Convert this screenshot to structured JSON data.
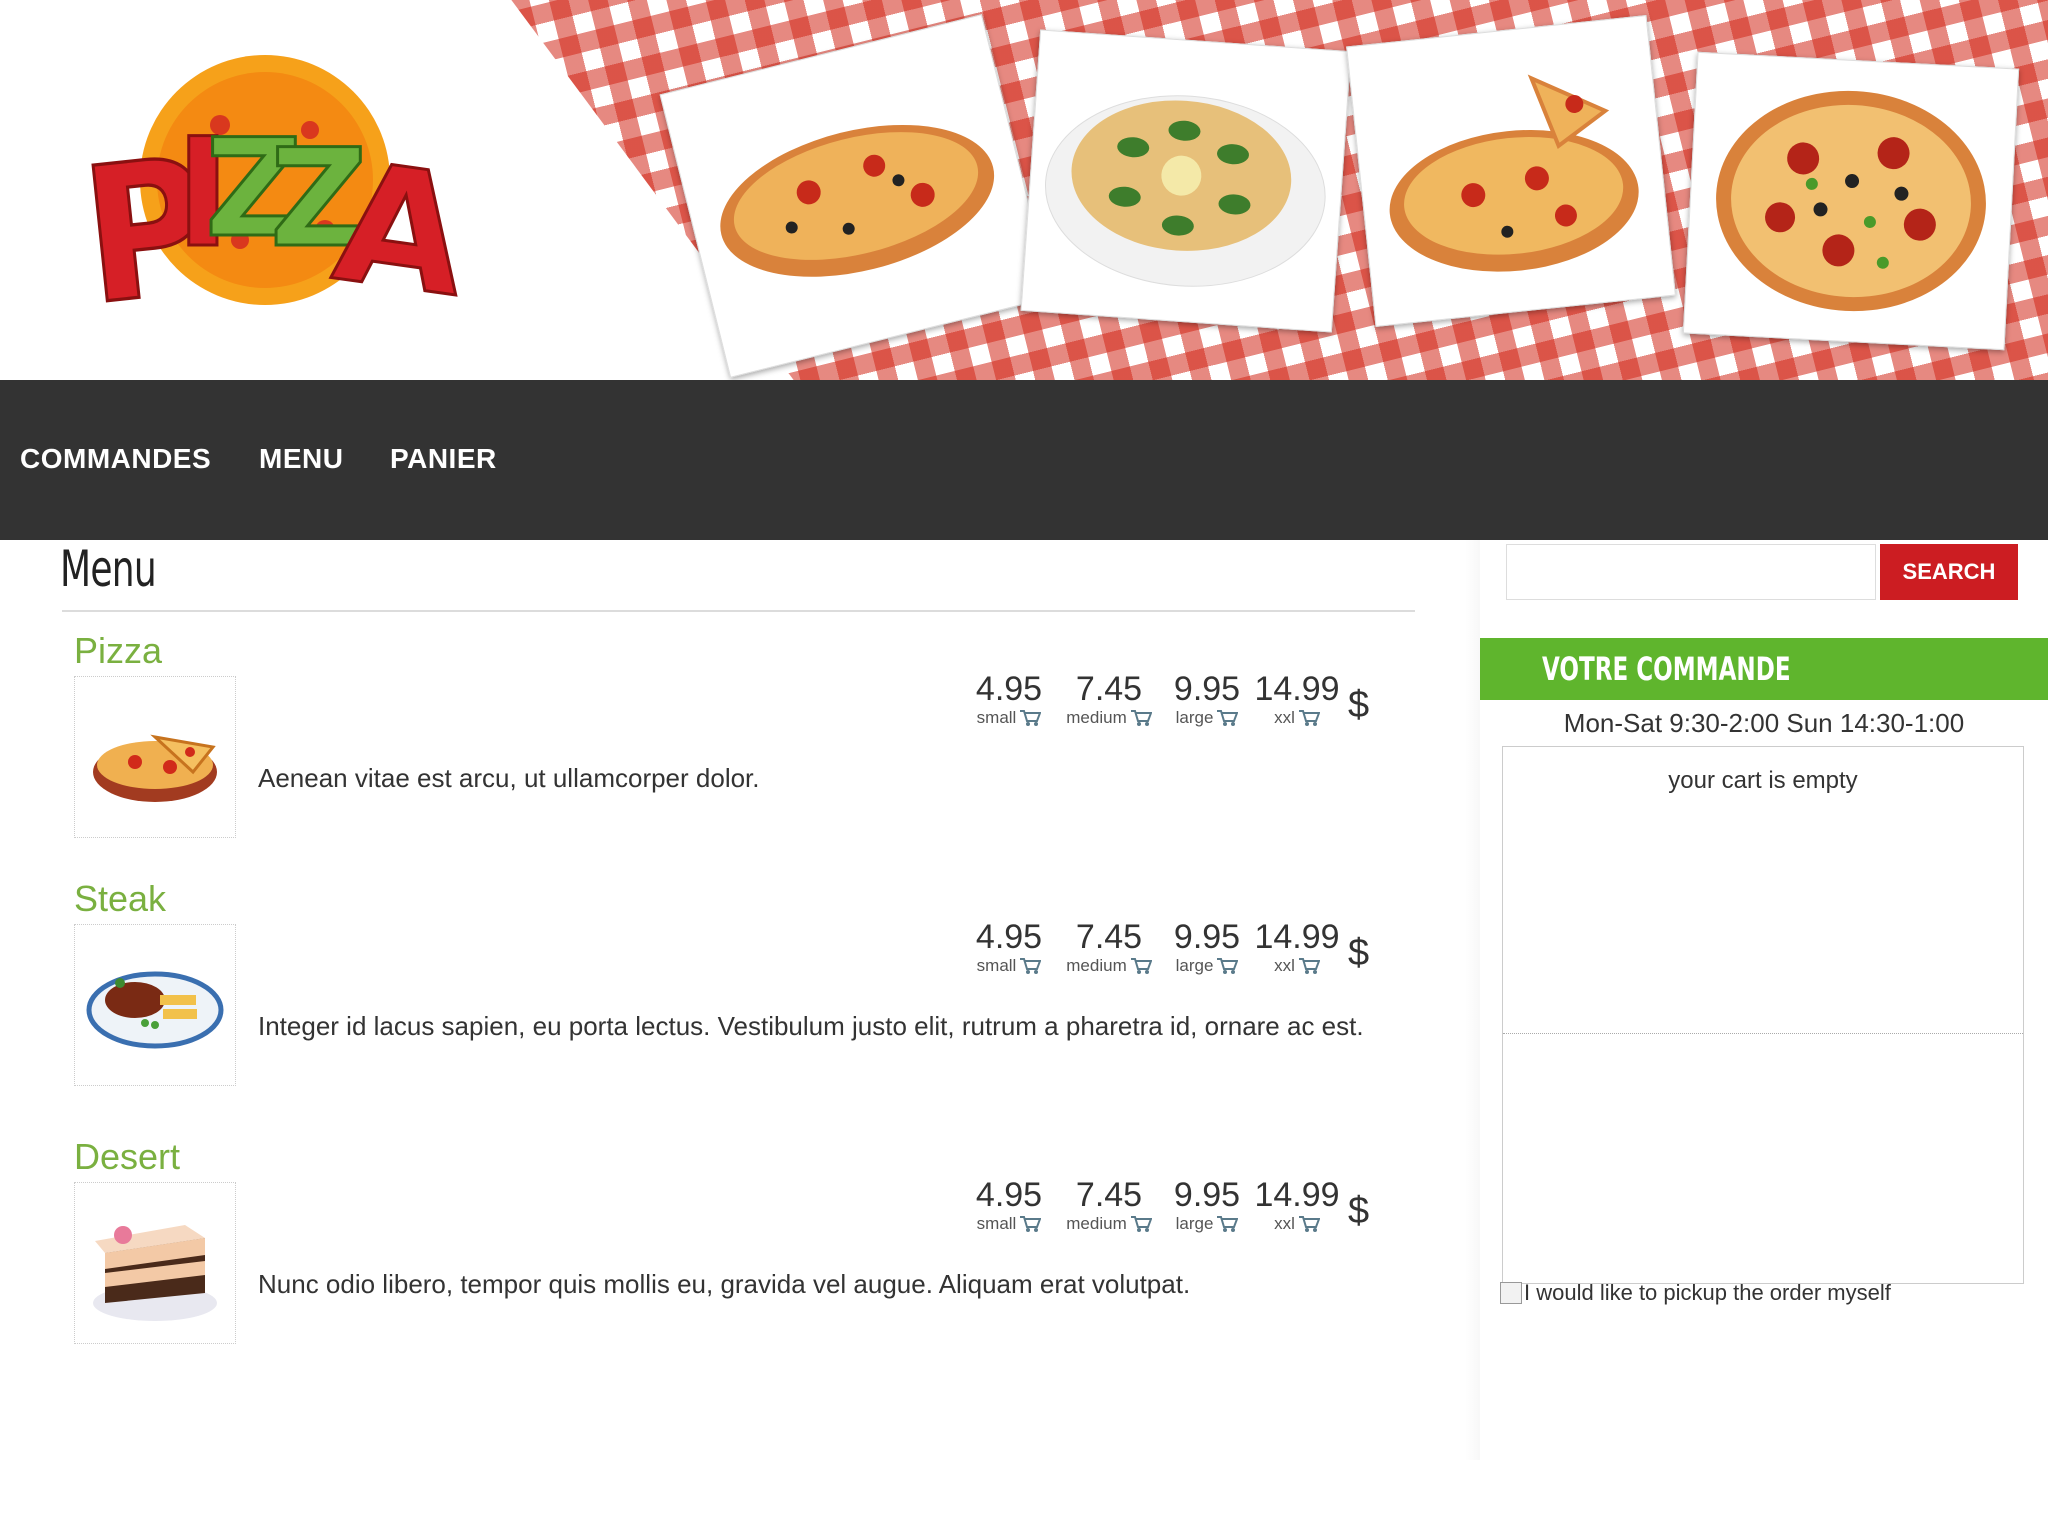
{
  "header": {
    "logo_text": "PIZZA"
  },
  "nav": {
    "items": [
      {
        "label": "COMMANDES"
      },
      {
        "label": "MENU"
      },
      {
        "label": "PANIER"
      }
    ]
  },
  "main": {
    "title": "Menu",
    "items": [
      {
        "name": "Pizza",
        "description": "Aenean vitae est arcu, ut ullamcorper dolor.",
        "prices": [
          {
            "amount": "4.95",
            "size": "small"
          },
          {
            "amount": "7.45",
            "size": "medium"
          },
          {
            "amount": "9.95",
            "size": "large"
          },
          {
            "amount": "14.99",
            "size": "xxl"
          }
        ],
        "currency": "$"
      },
      {
        "name": "Steak",
        "description": "Integer id lacus sapien, eu porta lectus. Vestibulum justo elit, rutrum a pharetra id, ornare ac est.",
        "prices": [
          {
            "amount": "4.95",
            "size": "small"
          },
          {
            "amount": "7.45",
            "size": "medium"
          },
          {
            "amount": "9.95",
            "size": "large"
          },
          {
            "amount": "14.99",
            "size": "xxl"
          }
        ],
        "currency": "$"
      },
      {
        "name": "Desert",
        "description": "Nunc odio libero, tempor quis mollis eu, gravida vel augue. Aliquam erat volutpat.",
        "prices": [
          {
            "amount": "4.95",
            "size": "small"
          },
          {
            "amount": "7.45",
            "size": "medium"
          },
          {
            "amount": "9.95",
            "size": "large"
          },
          {
            "amount": "14.99",
            "size": "xxl"
          }
        ],
        "currency": "$"
      }
    ]
  },
  "sidebar": {
    "search": {
      "placeholder": "",
      "value": "",
      "button_label": "SEARCH"
    },
    "order": {
      "title": "VOTRE COMMANDE",
      "hours": "Mon-Sat 9:30-2:00 Sun 14:30-1:00",
      "cart_empty": "your cart is empty",
      "pickup_label": "I would like to pickup the order myself",
      "pickup_checked": false
    }
  },
  "colors": {
    "accent_green": "#7ab040",
    "order_header_green": "#5fb52d",
    "search_red": "#cc1d22",
    "nav_dark": "#333333"
  }
}
